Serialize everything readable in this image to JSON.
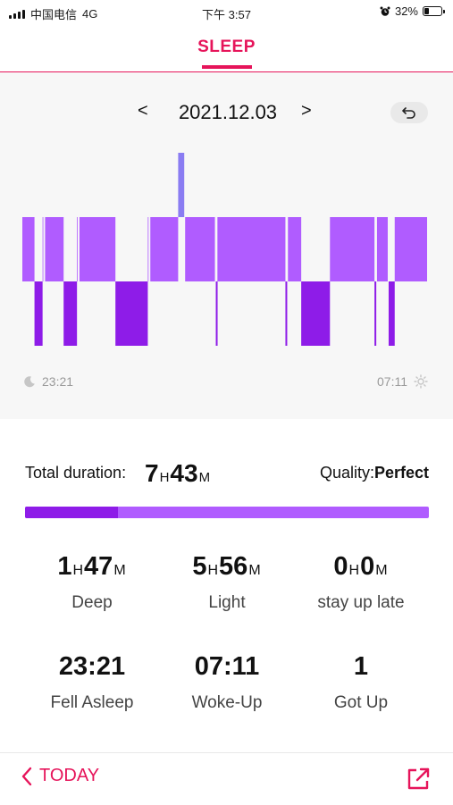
{
  "status_bar": {
    "carrier": "中国电信",
    "network": "4G",
    "time": "下午 3:57",
    "battery": "32%",
    "battery_level": 0.32
  },
  "header": {
    "title": "SLEEP"
  },
  "date_nav": {
    "prev": "<",
    "date": "2021.12.03",
    "next": ">"
  },
  "chart_labels": {
    "start": "23:21",
    "end": "07:11"
  },
  "chart_data": {
    "type": "timeline",
    "colors": {
      "light": "#b05cff",
      "deep": "#8e1ce8",
      "awake": "#8a7cf2"
    },
    "stages": [
      "awake",
      "light",
      "deep"
    ],
    "segments": [
      {
        "start": 0.0,
        "end": 0.03,
        "stage": "light"
      },
      {
        "start": 0.03,
        "end": 0.05,
        "stage": "deep"
      },
      {
        "start": 0.05,
        "end": 0.102,
        "stage": "light"
      },
      {
        "start": 0.102,
        "end": 0.135,
        "stage": "deep"
      },
      {
        "start": 0.135,
        "end": 0.23,
        "stage": "light"
      },
      {
        "start": 0.23,
        "end": 0.31,
        "stage": "deep"
      },
      {
        "start": 0.31,
        "end": 0.385,
        "stage": "light"
      },
      {
        "start": 0.385,
        "end": 0.4,
        "stage": "awake"
      },
      {
        "start": 0.4,
        "end": 0.478,
        "stage": "light"
      },
      {
        "start": 0.478,
        "end": 0.482,
        "stage": "deep"
      },
      {
        "start": 0.482,
        "end": 0.65,
        "stage": "light"
      },
      {
        "start": 0.65,
        "end": 0.654,
        "stage": "deep"
      },
      {
        "start": 0.654,
        "end": 0.689,
        "stage": "light"
      },
      {
        "start": 0.689,
        "end": 0.76,
        "stage": "deep"
      },
      {
        "start": 0.76,
        "end": 0.87,
        "stage": "light"
      },
      {
        "start": 0.87,
        "end": 0.874,
        "stage": "deep"
      },
      {
        "start": 0.874,
        "end": 0.905,
        "stage": "light"
      },
      {
        "start": 0.905,
        "end": 0.92,
        "stage": "deep"
      },
      {
        "start": 0.92,
        "end": 1.0,
        "stage": "light"
      }
    ],
    "dividers": [
      0.054,
      0.139,
      0.314,
      0.4,
      0.478,
      0.654,
      0.874,
      0.905
    ]
  },
  "summary": {
    "total_label": "Total duration:",
    "total_h": "7",
    "total_m": "43",
    "quality_label": "Quality:",
    "quality_value": "Perfect",
    "deep_fraction": 0.23
  },
  "units": {
    "h": "H",
    "m": "M"
  },
  "stats": {
    "deep": {
      "h": "1",
      "m": "47",
      "label": "Deep"
    },
    "light": {
      "h": "5",
      "m": "56",
      "label": "Light"
    },
    "late": {
      "h": "0",
      "m": "0",
      "label": "stay up late"
    },
    "fell_asleep": {
      "value": "23:21",
      "label": "Fell Asleep"
    },
    "woke_up": {
      "value": "07:11",
      "label": "Woke-Up"
    },
    "got_up": {
      "value": "1",
      "label": "Got Up"
    }
  },
  "bottom": {
    "today_label": "TODAY"
  },
  "icons": [
    "moon-icon",
    "sun-icon",
    "return-icon",
    "chevron-left-icon",
    "share-icon",
    "alarm-icon",
    "battery-icon",
    "signal-icon"
  ]
}
